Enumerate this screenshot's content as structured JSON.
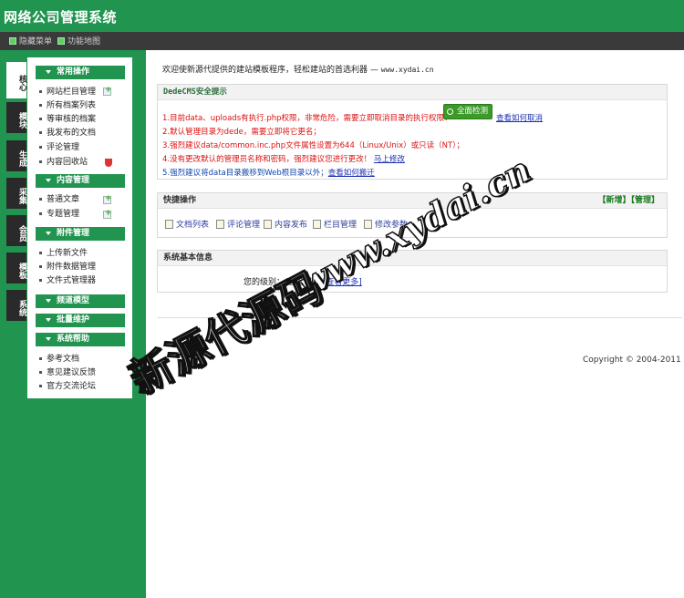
{
  "app": {
    "title": "网络公司管理系统"
  },
  "toolbar": {
    "hide_menu": "隐藏菜单",
    "function_map": "功能地图"
  },
  "side_tabs": [
    "核心",
    "模块",
    "生成",
    "采集",
    "会员",
    "模板",
    "系统"
  ],
  "menu": {
    "groups": [
      {
        "title": "常用操作",
        "items": [
          "网站栏目管理",
          "所有档案列表",
          "等审核的档案",
          "我发布的文档",
          "评论管理",
          "内容回收站"
        ]
      },
      {
        "title": "内容管理",
        "items": [
          "普通文章",
          "专题管理"
        ]
      },
      {
        "title": "附件管理",
        "items": [
          "上传新文件",
          "附件数据管理",
          "文件式管理器"
        ]
      },
      {
        "title": "频道模型",
        "items": []
      },
      {
        "title": "批量维护",
        "items": []
      },
      {
        "title": "系统帮助",
        "items": [
          "参考文档",
          "意见建议反馈",
          "官方交流论坛"
        ]
      }
    ]
  },
  "welcome": {
    "text": "欢迎使新源代提供的建站模板程序，轻松建站的首选利器 —",
    "site": "www.xydai.cn"
  },
  "security": {
    "title": "DedeCMS安全提示",
    "line1": "1.目前data、uploads有执行.php权限，非常危险，需要立即取消目录的执行权限！",
    "check_button": "全面检测",
    "line1_link": "查看如何取消",
    "line2": "2.默认管理目录为dede，需要立即将它更名；",
    "line3": "3.强烈建议data/common.inc.php文件属性设置为644（Linux/Unix）或只读（NT）；",
    "line4": "4.没有更改默认的管理员名称和密码，强烈建议您进行更改！",
    "line4_link": "马上修改",
    "line5": "5.强烈建议将data目录搬移到Web根目录以外；",
    "line5_link": "查看如何搬迁"
  },
  "quick_ops": {
    "title": "快捷操作",
    "links_text": "【新增】【管理】",
    "items": [
      "文档列表",
      "评论管理",
      "内容发布",
      "栏目管理",
      "修改参数"
    ]
  },
  "sysinfo": {
    "title": "系统基本信息",
    "level_label": "您的级别：",
    "level_value": "总管理员",
    "more": "[查看更多]"
  },
  "copyright": "Copyright © 2004-2011",
  "watermark": {
    "url": "www.xydai.cn",
    "brand": "新源代源码"
  }
}
